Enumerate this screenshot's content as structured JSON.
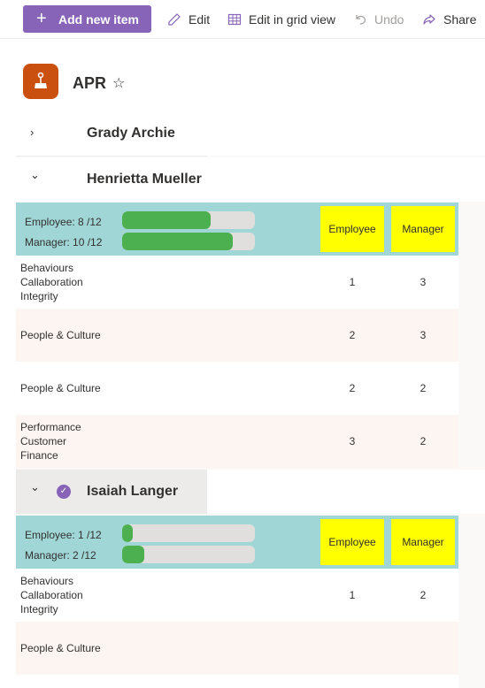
{
  "toolbar": {
    "add_label": "Add new item",
    "edit_label": "Edit",
    "grid_label": "Edit in grid view",
    "undo_label": "Undo",
    "share_label": "Share"
  },
  "header": {
    "title": "APR",
    "star": "☆"
  },
  "groups": [
    {
      "name": "Grady Archie",
      "chevron": "›"
    },
    {
      "name": "Henrietta Mueller",
      "chevron": "⌄",
      "summary": {
        "employee_label": "Employee: 8 /12",
        "manager_label": "Manager: 10 /12",
        "employee_progress": 0.667,
        "manager_progress": 0.833,
        "col_employee": "Employee",
        "col_manager": "Manager"
      },
      "rows": [
        {
          "category": [
            "Behaviours",
            "Callaboration",
            "Integrity"
          ],
          "employee": "1",
          "manager": "3"
        },
        {
          "category": [
            "People & Culture"
          ],
          "employee": "2",
          "manager": "3"
        },
        {
          "category": [
            "People & Culture"
          ],
          "employee": "2",
          "manager": "2"
        },
        {
          "category": [
            "Performance",
            "Customer",
            "Finance"
          ],
          "employee": "3",
          "manager": "2"
        }
      ]
    },
    {
      "name": "Isaiah Langer",
      "chevron": "⌄",
      "summary": {
        "employee_label": "Employee: 1 /12",
        "manager_label": "Manager: 2 /12",
        "employee_progress": 0.083,
        "manager_progress": 0.167,
        "col_employee": "Employee",
        "col_manager": "Manager"
      },
      "rows": [
        {
          "category": [
            "Behaviours",
            "Callaboration",
            "Integrity"
          ],
          "employee": "1",
          "manager": "2"
        },
        {
          "category": [
            "People & Culture"
          ],
          "employee": "",
          "manager": ""
        }
      ]
    }
  ],
  "colors": {
    "accent": "#8764b8",
    "summary_bg": "#a0d6d6",
    "highlight": "#ffff00",
    "progress": "#4caf50",
    "logo": "#ca5010"
  }
}
